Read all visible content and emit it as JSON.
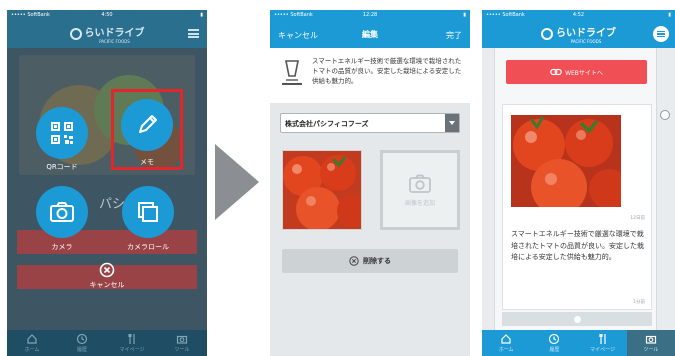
{
  "colors": {
    "accent": "#1c9ad6",
    "highlight": "#e3262b",
    "web_button": "#ef4f55"
  },
  "phone1": {
    "status": {
      "carrier": "••••• SoftBank",
      "time": "4:50",
      "battery": "▮"
    },
    "brand": "らいドライブ",
    "brand_sub": "PACIFIC FOODS",
    "menu_icon": "hamburger-icon",
    "actions": [
      {
        "label": "QRコード",
        "icon": "qr-icon"
      },
      {
        "label": "メモ",
        "icon": "pencil-icon",
        "highlighted": true
      },
      {
        "label": "カメラ",
        "icon": "camera-icon"
      },
      {
        "label": "カメラロール",
        "icon": "gallery-icon"
      }
    ],
    "bg_text": "パシフィ",
    "cancel_label": "キャンセル",
    "tabs": [
      "ホーム",
      "履歴",
      "マイページ",
      "ツール"
    ]
  },
  "arrow_icon": "triangle-right-icon",
  "phone2": {
    "status": {
      "carrier": "••••• SoftBank",
      "time": "12:28",
      "battery": "▮"
    },
    "nav_cancel": "キャンセル",
    "nav_title": "編集",
    "nav_done": "完了",
    "memo_text": "スマートエネルギー技術で厳選な環境で栽培されたトマトの品質が良い。安定した栽培による安定した供給も魅力的。",
    "company_select": "株式会社パシフィコフーズ",
    "add_photo_label": "画像を追加",
    "delete_label": "削除する"
  },
  "phone3": {
    "status": {
      "carrier": "••••• SoftBank",
      "time": "4:52",
      "battery": "▮"
    },
    "brand": "らいドライブ",
    "brand_sub": "PACIFIC FOODS",
    "web_button": "WEBサイトへ",
    "time_label": "12日前",
    "memo_text": "スマートエネルギー技術で厳選な環境で栽培されたトマトの品質が良い。安定した栽培による安定した供給も魅力的。",
    "footer_label": "1分前",
    "tabs": [
      "ホーム",
      "履歴",
      "マイページ",
      "ツール"
    ]
  }
}
